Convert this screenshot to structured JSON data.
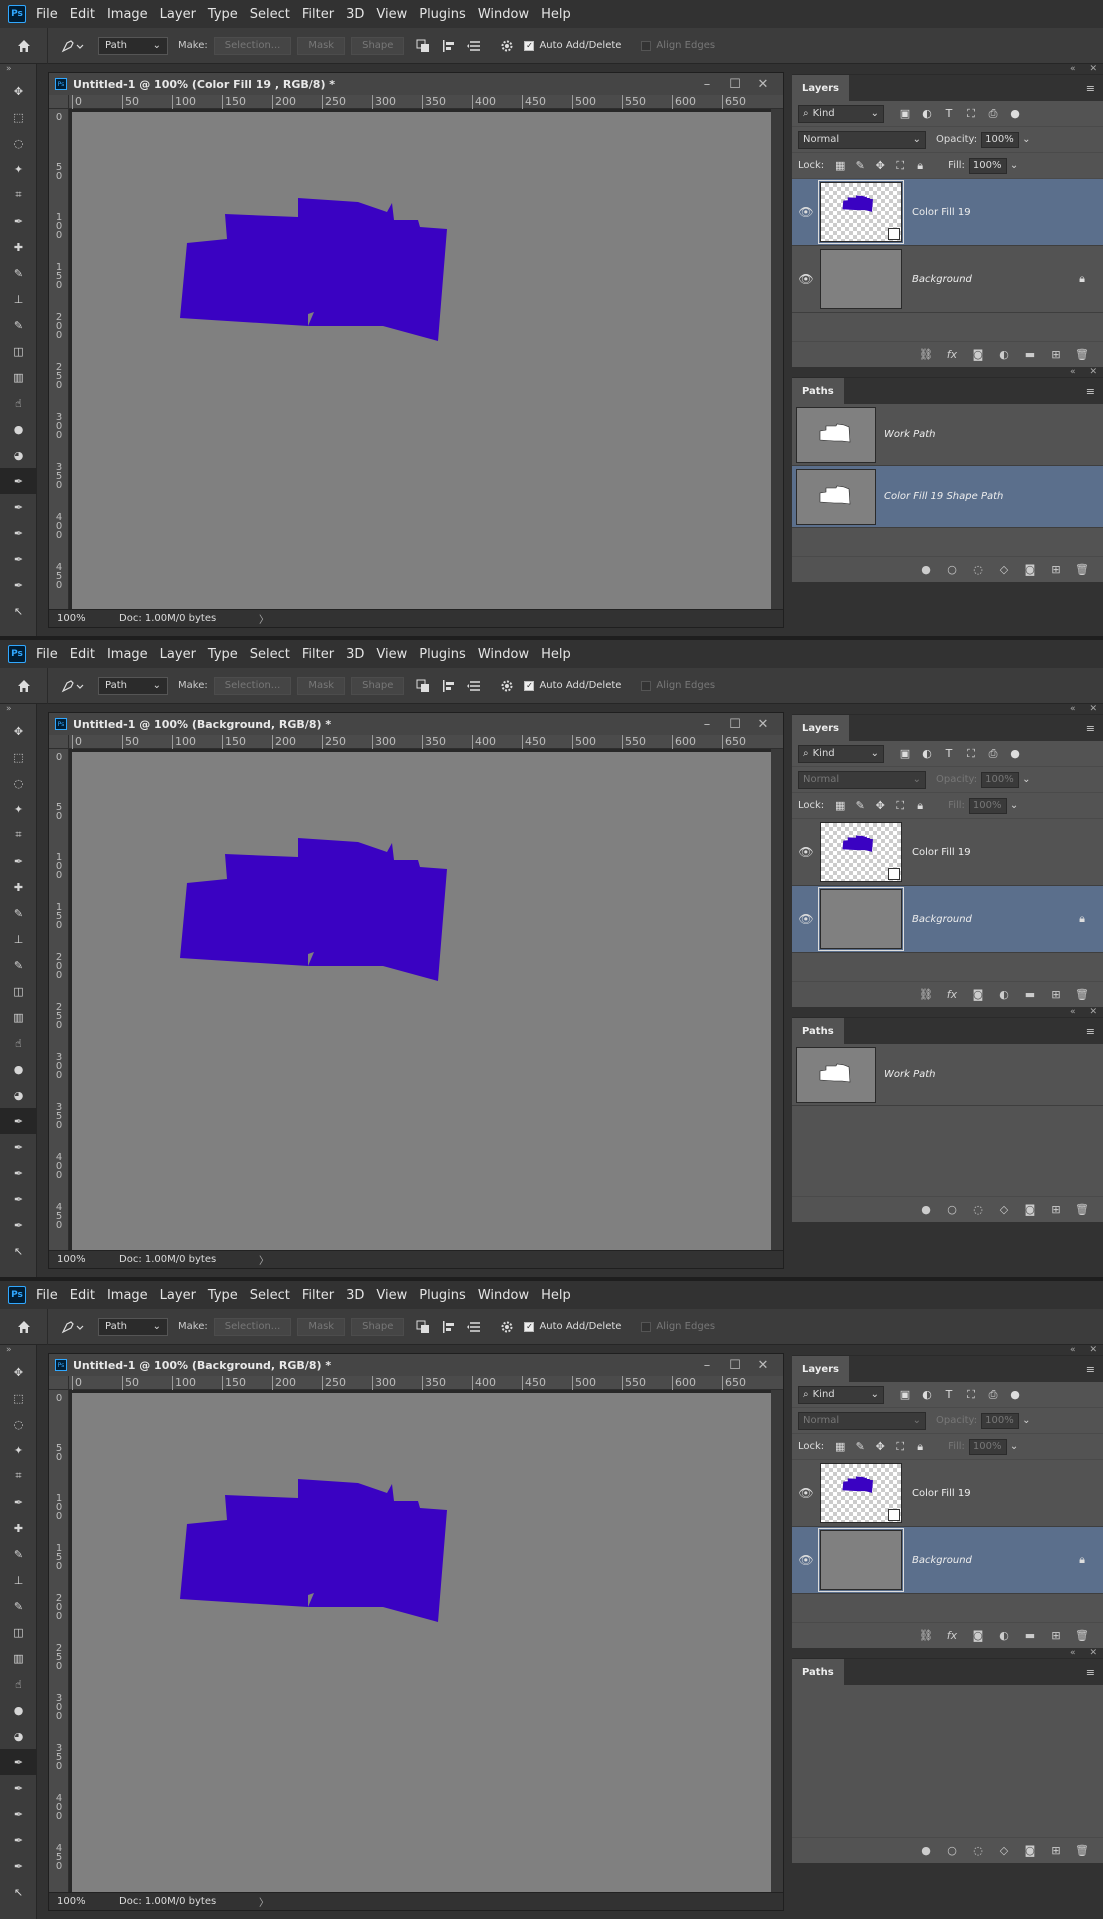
{
  "app": {
    "logo": "Ps",
    "menu": [
      "File",
      "Edit",
      "Image",
      "Layer",
      "Type",
      "Select",
      "Filter",
      "3D",
      "View",
      "Plugins",
      "Window",
      "Help"
    ]
  },
  "options_bar": {
    "mode_select": "Path",
    "make_label": "Make:",
    "selection_btn": "Selection...",
    "mask_btn": "Mask",
    "shape_btn": "Shape",
    "auto_add_delete": "Auto Add/Delete",
    "align_edges": "Align Edges"
  },
  "ruler": {
    "h_ticks": [
      "0",
      "50",
      "100",
      "150",
      "200",
      "250",
      "300",
      "350",
      "400",
      "450",
      "500",
      "550",
      "600",
      "650"
    ],
    "v_ticks": [
      [
        "0"
      ],
      [
        "5",
        "0"
      ],
      [
        "1",
        "0",
        "0"
      ],
      [
        "1",
        "5",
        "0"
      ],
      [
        "2",
        "0",
        "0"
      ],
      [
        "2",
        "5",
        "0"
      ],
      [
        "3",
        "0",
        "0"
      ],
      [
        "3",
        "5",
        "0"
      ],
      [
        "4",
        "0",
        "0"
      ],
      [
        "4",
        "5",
        "0"
      ]
    ]
  },
  "status": {
    "zoom": "100%",
    "doc": "Doc: 1.00M/0 bytes",
    "arrow": "〉"
  },
  "layers_panel": {
    "tab": "Layers",
    "kind": "Kind",
    "blend_mode": "Normal",
    "opacity_label": "Opacity:",
    "opacity": "100%",
    "lock_label": "Lock:",
    "fill_label": "Fill:",
    "fill": "100%",
    "layers": [
      "Color Fill 19",
      "Background"
    ]
  },
  "paths_panel": {
    "tab": "Paths",
    "work_path": "Work Path",
    "shape_path": "Color Fill 19  Shape Path"
  },
  "screens": [
    {
      "doc_title": "Untitled-1 @ 100% (Color Fill 19 , RGB/8) *",
      "selected_layer": 0,
      "show_shape_path": true,
      "show_work_path": true
    },
    {
      "doc_title": "Untitled-1 @ 100% (Background, RGB/8) *",
      "selected_layer": 1,
      "show_shape_path": false,
      "show_work_path": true
    },
    {
      "doc_title": "Untitled-1 @ 100% (Background, RGB/8) *",
      "selected_layer": 1,
      "show_shape_path": false,
      "show_work_path": false
    }
  ],
  "colors": {
    "shape_fill": "#3a02c2",
    "canvas": "#808080",
    "selection": "#5b6f8c"
  }
}
